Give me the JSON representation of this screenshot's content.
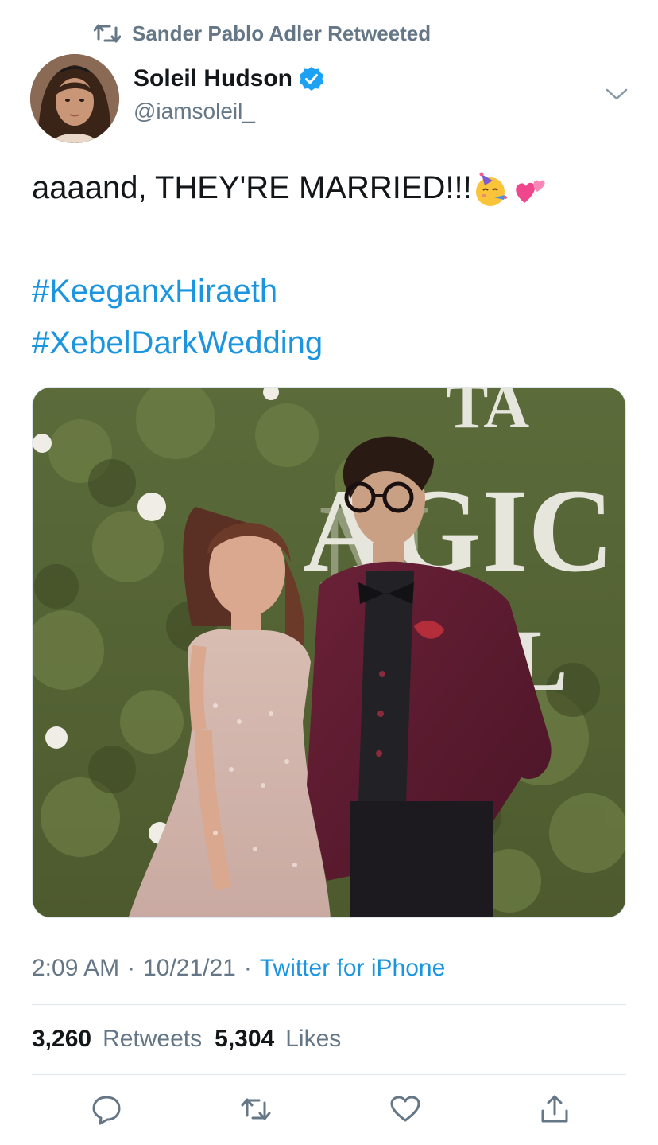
{
  "retweet_context": {
    "text": "Sander Pablo Adler Retweeted"
  },
  "author": {
    "name": "Soleil Hudson",
    "handle": "@iamsoleil_",
    "verified": true
  },
  "tweet": {
    "text": "aaaand, THEY'RE MARRIED!!!",
    "emojis": [
      "partying-face-emoji",
      "two-hearts-emoji"
    ],
    "hashtags": [
      "#KeeganxHiraeth",
      "#XebelDarkWedding"
    ]
  },
  "meta": {
    "time": "2:09 AM",
    "separator": "·",
    "date": "10/21/21",
    "source": "Twitter for iPhone"
  },
  "stats": {
    "retweets_count": "3,260",
    "retweets_label": "Retweets",
    "likes_count": "5,304",
    "likes_label": "Likes"
  },
  "actions": [
    "reply-icon",
    "retweet-icon",
    "like-icon",
    "share-icon"
  ],
  "colors": {
    "link": "#1b95e0",
    "secondary_text": "#657786",
    "primary_text": "#14171a",
    "divider": "#e1e8ed",
    "verified": "#1da1f2"
  }
}
